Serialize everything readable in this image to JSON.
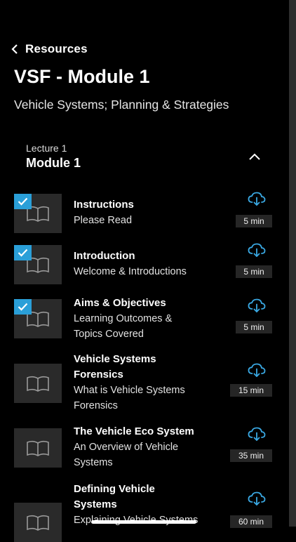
{
  "nav": {
    "back_label": "Resources"
  },
  "header": {
    "title": "VSF - Module 1",
    "subtitle": "Vehicle Systems; Planning & Strategies"
  },
  "lecture": {
    "kicker": "Lecture 1",
    "title": "Module 1"
  },
  "items": [
    {
      "title_lines": [
        "Instructions"
      ],
      "subtitle_lines": [
        "Please Read"
      ],
      "duration": "5 min",
      "completed": true
    },
    {
      "title_lines": [
        "Introduction"
      ],
      "subtitle_lines": [
        "Welcome & Introductions"
      ],
      "duration": "5 min",
      "completed": true
    },
    {
      "title_lines": [
        "Aims & Objectives"
      ],
      "subtitle_lines": [
        "Learning Outcomes &",
        "Topics Covered"
      ],
      "duration": "5 min",
      "completed": true
    },
    {
      "title_lines": [
        "Vehicle Systems",
        "Forensics"
      ],
      "subtitle_lines": [
        "What is Vehicle Systems",
        "Forensics"
      ],
      "duration": "15 min",
      "completed": false
    },
    {
      "title_lines": [
        "The Vehicle Eco System"
      ],
      "subtitle_lines": [
        "An Overview of Vehicle",
        "Systems"
      ],
      "duration": "35 min",
      "completed": false
    },
    {
      "title_lines": [
        "Defining Vehicle",
        "Systems"
      ],
      "subtitle_lines": [
        "Explaining Vehicle Systems"
      ],
      "duration": "60 min",
      "completed": false
    }
  ],
  "colors": {
    "accent": "#2a9fd8",
    "background": "#000000",
    "thumbnail": "#2a2a2a",
    "badge": "#262626"
  },
  "icons": {
    "back": "chevron-left-icon",
    "collapse": "chevron-up-icon",
    "lesson": "book-icon",
    "download": "cloud-download-icon",
    "done": "checkmark-icon"
  }
}
